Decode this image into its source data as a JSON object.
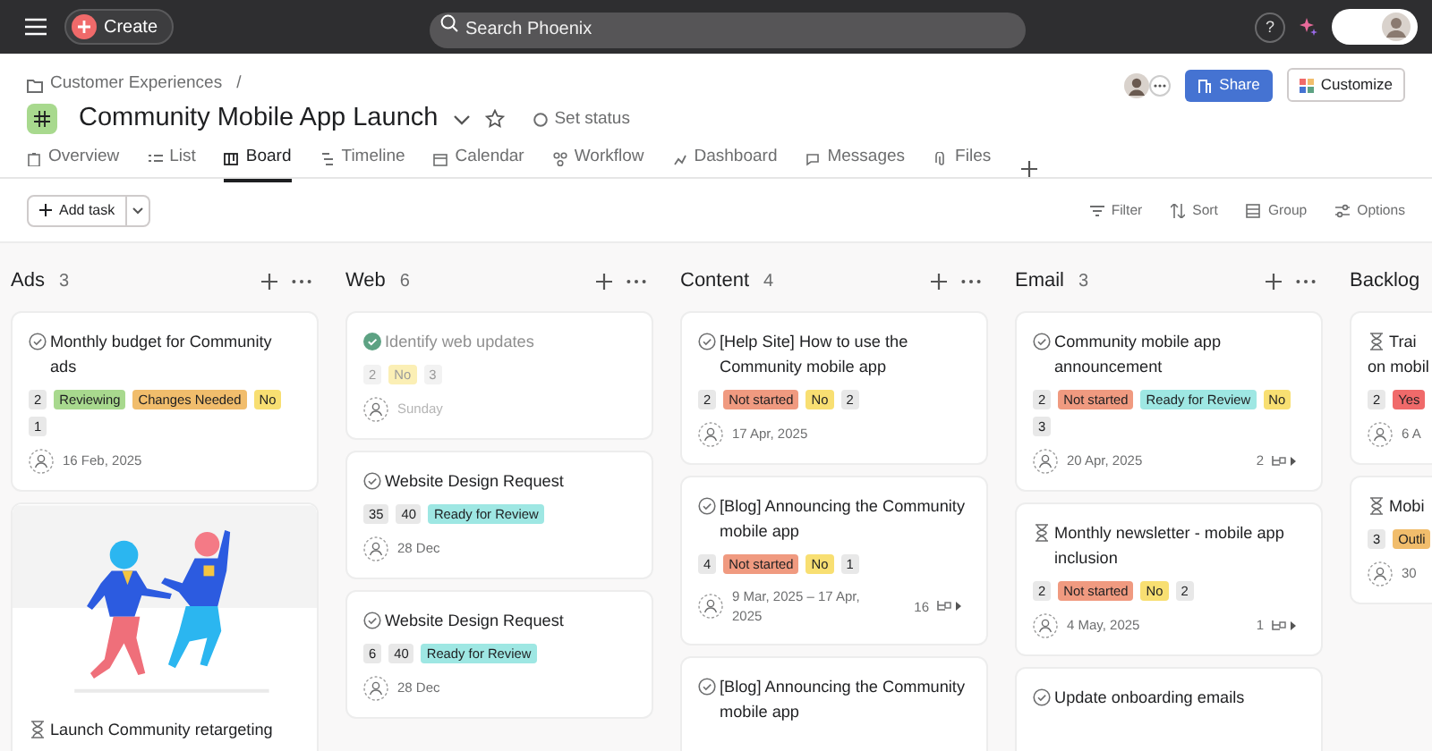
{
  "topbar": {
    "create_label": "Create",
    "search": {
      "placeholder": "Search Phoenix"
    },
    "help_label": "?"
  },
  "project": {
    "breadcrumb": "Customer Experiences",
    "breadcrumb_separator": "/",
    "title": "Community Mobile App Launch",
    "status_label": "Set status",
    "share_label": "Share",
    "customize_label": "Customize"
  },
  "tabs": [
    {
      "label": "Overview",
      "selected": false
    },
    {
      "label": "List",
      "selected": false
    },
    {
      "label": "Board",
      "selected": true
    },
    {
      "label": "Timeline",
      "selected": false
    },
    {
      "label": "Calendar",
      "selected": false
    },
    {
      "label": "Workflow",
      "selected": false
    },
    {
      "label": "Dashboard",
      "selected": false
    },
    {
      "label": "Messages",
      "selected": false
    },
    {
      "label": "Files",
      "selected": false
    }
  ],
  "toolbar": {
    "add_label": "Add task",
    "actions": [
      "Filter",
      "Sort",
      "Group",
      "Options"
    ]
  },
  "columns": [
    {
      "name": "Ads",
      "count": "3",
      "cards": [
        {
          "kind": "task",
          "title": "Monthly budget for Community ads",
          "tags": [
            {
              "label": "2",
              "color": "#e8e8e8"
            },
            {
              "label": "Reviewing",
              "color": "#a8d98e"
            },
            {
              "label": "Changes Needed",
              "color": "#f1bd6c"
            },
            {
              "label": "No",
              "color": "#f8df72"
            },
            {
              "label": "1",
              "color": "#e8e8e8"
            }
          ],
          "date": "16 Feb, 2025"
        },
        {
          "kind": "approval",
          "cover": true,
          "title": "Launch Community retargeting"
        }
      ]
    },
    {
      "name": "Web",
      "count": "6",
      "cards": [
        {
          "kind": "completed",
          "title": "Identify web updates",
          "tags": [
            {
              "label": "2",
              "color": "#f2f2f2"
            },
            {
              "label": "No",
              "color": "#fbefb5"
            },
            {
              "label": "3",
              "color": "#f2f2f2"
            }
          ],
          "date": "Sunday"
        },
        {
          "kind": "task",
          "title": "Website Design Request",
          "tags": [
            {
              "label": "35",
              "color": "#e8e8e8"
            },
            {
              "label": "40",
              "color": "#e8e8e8"
            },
            {
              "label": "Ready for Review",
              "color": "#9ee7e3"
            }
          ],
          "date": "28 Dec"
        },
        {
          "kind": "task",
          "title": "Website Design Request",
          "tags": [
            {
              "label": "6",
              "color": "#e8e8e8"
            },
            {
              "label": "40",
              "color": "#e8e8e8"
            },
            {
              "label": "Ready for Review",
              "color": "#9ee7e3"
            }
          ],
          "date": "28 Dec"
        }
      ]
    },
    {
      "name": "Content",
      "count": "4",
      "cards": [
        {
          "kind": "task",
          "title": "[Help Site] How to use the Community mobile app",
          "tags": [
            {
              "label": "2",
              "color": "#e8e8e8"
            },
            {
              "label": "Not started",
              "color": "#f09a80"
            },
            {
              "label": "No",
              "color": "#f8df72"
            },
            {
              "label": "2",
              "color": "#e8e8e8"
            }
          ],
          "date": "17 Apr, 2025"
        },
        {
          "kind": "task",
          "title": "[Blog] Announcing the Community mobile app",
          "tags": [
            {
              "label": "4",
              "color": "#e8e8e8"
            },
            {
              "label": "Not started",
              "color": "#f09a80"
            },
            {
              "label": "No",
              "color": "#f8df72"
            },
            {
              "label": "1",
              "color": "#e8e8e8"
            }
          ],
          "date": "9 Mar, 2025 – 17 Apr, 2025",
          "subtasks": "16"
        },
        {
          "kind": "task",
          "title": "[Blog] Announcing the Community mobile app"
        }
      ]
    },
    {
      "name": "Email",
      "count": "3",
      "cards": [
        {
          "kind": "task",
          "title": "Community mobile app announcement",
          "tags": [
            {
              "label": "2",
              "color": "#e8e8e8"
            },
            {
              "label": "Not started",
              "color": "#f09a80"
            },
            {
              "label": "Ready for Review",
              "color": "#9ee7e3"
            },
            {
              "label": "No",
              "color": "#f8df72"
            },
            {
              "label": "3",
              "color": "#e8e8e8"
            }
          ],
          "date": "20 Apr, 2025",
          "subtasks": "2"
        },
        {
          "kind": "approval",
          "title": "Monthly newsletter - mobile app inclusion",
          "tags": [
            {
              "label": "2",
              "color": "#e8e8e8"
            },
            {
              "label": "Not started",
              "color": "#f09a80"
            },
            {
              "label": "No",
              "color": "#f8df72"
            },
            {
              "label": "2",
              "color": "#e8e8e8"
            }
          ],
          "date": "4 May, 2025",
          "subtasks": "1"
        },
        {
          "kind": "task",
          "title": "Update onboarding emails"
        }
      ]
    },
    {
      "name": "Backlog",
      "cards": [
        {
          "kind": "approval",
          "title_lines": [
            "Trai",
            "on mobil"
          ],
          "tags": [
            {
              "label": "2",
              "color": "#e8e8e8"
            },
            {
              "label": "Yes",
              "color": "#f06a6a"
            }
          ],
          "date": "6 A"
        },
        {
          "kind": "approval",
          "title": "Mobi",
          "tags": [
            {
              "label": "3",
              "color": "#e8e8e8"
            },
            {
              "label": "Outli",
              "color": "#f1bd6c"
            }
          ],
          "date": "30"
        }
      ]
    }
  ]
}
